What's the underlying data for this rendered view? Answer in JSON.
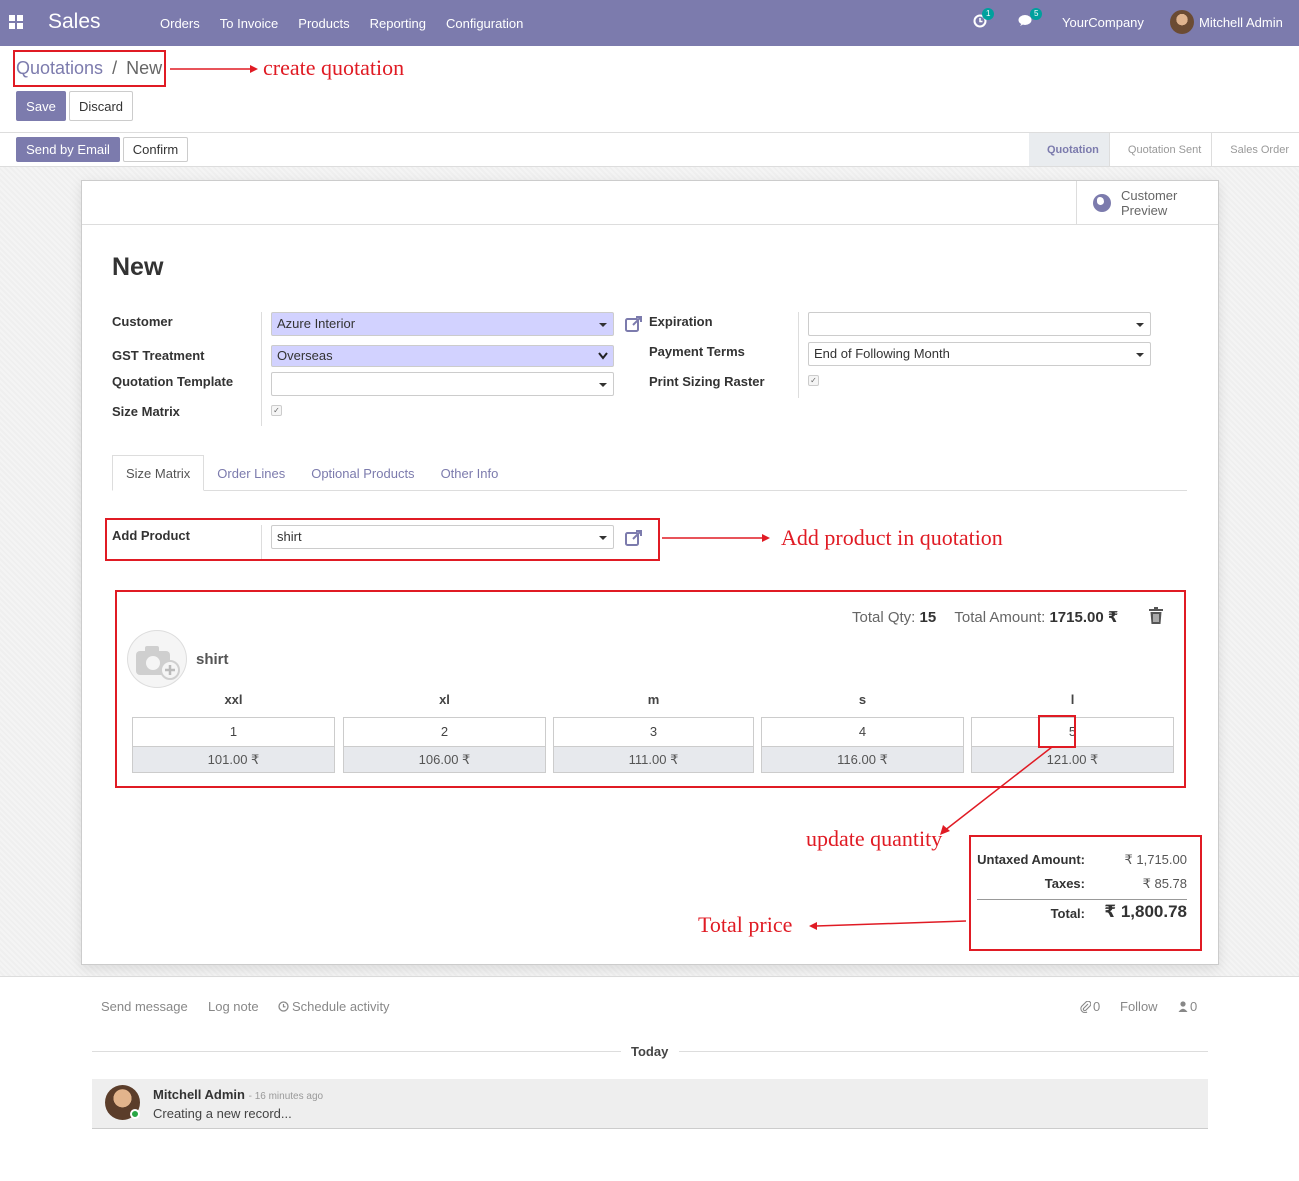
{
  "navbar": {
    "app_name": "Sales",
    "menu": [
      "Orders",
      "To Invoice",
      "Products",
      "Reporting",
      "Configuration"
    ],
    "activity_count": "1",
    "message_count": "5",
    "company": "YourCompany",
    "user": "Mitchell Admin"
  },
  "breadcrumb": {
    "parent": "Quotations",
    "separator": "/",
    "current": "New"
  },
  "buttons": {
    "save": "Save",
    "discard": "Discard",
    "send_email": "Send by Email",
    "confirm": "Confirm"
  },
  "stages": [
    "Quotation",
    "Quotation Sent",
    "Sales Order"
  ],
  "customer_preview": "Customer Preview",
  "record_title": "New",
  "form": {
    "customer_label": "Customer",
    "customer": "Azure Interior",
    "gst_label": "GST Treatment",
    "gst": "Overseas",
    "template_label": "Quotation Template",
    "template": "",
    "size_matrix_label": "Size Matrix",
    "expiration_label": "Expiration",
    "expiration": "",
    "payment_terms_label": "Payment Terms",
    "payment_terms": "End of Following Month",
    "print_raster_label": "Print Sizing Raster"
  },
  "tabs": [
    "Size Matrix",
    "Order Lines",
    "Optional Products",
    "Other Info"
  ],
  "add_product": {
    "label": "Add Product",
    "value": "shirt"
  },
  "matrix": {
    "total_qty_label": "Total Qty:",
    "total_qty": "15",
    "total_amount_label": "Total Amount:",
    "total_amount": "1715.00 ₹",
    "product": "shirt",
    "sizes": [
      "xxl",
      "xl",
      "m",
      "s",
      "l"
    ],
    "quantities": [
      "1",
      "2",
      "3",
      "4",
      "5"
    ],
    "prices": [
      "101.00 ₹",
      "106.00 ₹",
      "111.00 ₹",
      "116.00 ₹",
      "121.00 ₹"
    ]
  },
  "totals": {
    "untaxed_label": "Untaxed Amount:",
    "untaxed": "₹ 1,715.00",
    "taxes_label": "Taxes:",
    "taxes": "₹ 85.78",
    "total_label": "Total:",
    "total": "₹ 1,800.78"
  },
  "annotations": {
    "create": "create quotation",
    "add_product": "Add product in quotation",
    "update_qty": "update quantity",
    "total_price": "Total price"
  },
  "chatter": {
    "send_message": "Send message",
    "log_note": "Log note",
    "schedule": "Schedule activity",
    "attachments": "0",
    "follow": "Follow",
    "followers": "0",
    "today": "Today",
    "author": "Mitchell Admin",
    "time": "- 16 minutes ago",
    "body": "Creating a new record..."
  },
  "colors": {
    "brand": "#7c7bad",
    "annotation": "#e01b24",
    "required_field": "#d2d2ff"
  }
}
